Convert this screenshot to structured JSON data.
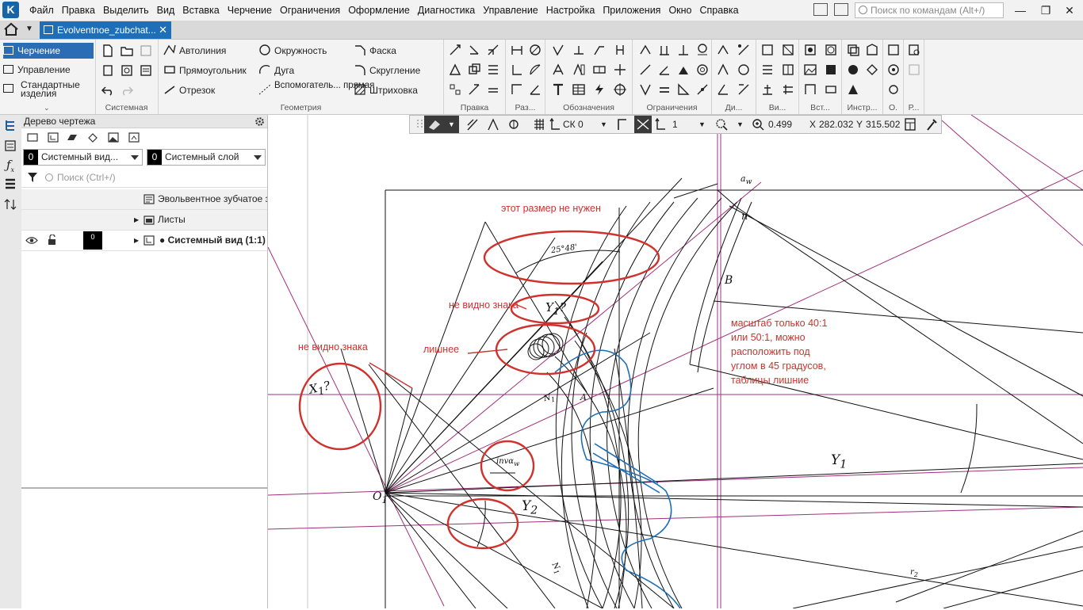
{
  "menu": [
    "Файл",
    "Правка",
    "Выделить",
    "Вид",
    "Вставка",
    "Черчение",
    "Ограничения",
    "Оформление",
    "Диагностика",
    "Управление",
    "Настройка",
    "Приложения",
    "Окно",
    "Справка"
  ],
  "search_placeholder": "Поиск по командам (Alt+/)",
  "doc_tab": "Evolventnoe_zubchat...",
  "ribbon": {
    "left": [
      "Черчение",
      "Управление",
      "Стандартные изделия"
    ],
    "sistemnaya_label": "Системная",
    "geometry_tools": [
      "Автолиния",
      "Прямоугольник",
      "Отрезок",
      "Окружность",
      "Дуга",
      "Вспомогатель... прямая",
      "Фаска",
      "Скругление",
      "Штриховка"
    ],
    "geometry_label": "Геометрия",
    "groups": [
      "Правка",
      "Раз...",
      "Обозначения",
      "Ограничения",
      "Ди...",
      "Ви...",
      "Вст...",
      "Инстр...",
      "О.",
      "Р..."
    ]
  },
  "panel": {
    "title": "Дерево чертежа",
    "view_combo": "Системный вид...",
    "view_num": "0",
    "layer_combo": "Системный слой",
    "layer_num": "0",
    "filter_placeholder": "Поиск (Ctrl+/)",
    "rows": [
      "Эвольвентное зубчатое з",
      "Листы",
      "● Системный вид (1:1)"
    ],
    "row_layer": "0"
  },
  "float_toolbar": {
    "sk": "СК 0",
    "step": "1",
    "zoom": "0.499",
    "x_label": "X",
    "x_value": "282.0323",
    "y_label": "Y",
    "y_value": "315.5026"
  },
  "annotations": [
    "этот размер не нужен",
    "не видно знака",
    "не видно знака",
    "лишнее",
    "масштаб только 40:1\nили 50:1, можно\nрасположить под\nуглом в 45 градусов,\nтаблицы лишние"
  ],
  "drawing_labels": {
    "aw": "a",
    "aw_sub": "w",
    "n": "n",
    "angle": "25°48'",
    "B": "B",
    "y1q": "Y",
    "y1q_sub": "1",
    "q": "?",
    "x1q": "X",
    "x1q_sub": "1",
    "inv": "inv",
    "inv_alpha": "α",
    "inv_sub": "w",
    "O1": "O",
    "O1_sub": "1",
    "Y1": "Y",
    "Y1_sub": "1",
    "Y2": "Y",
    "Y2_sub": "2",
    "N1": "N",
    "N1_sub": "1",
    "A": "A",
    "r2": "r",
    "r2_sub": "2"
  }
}
